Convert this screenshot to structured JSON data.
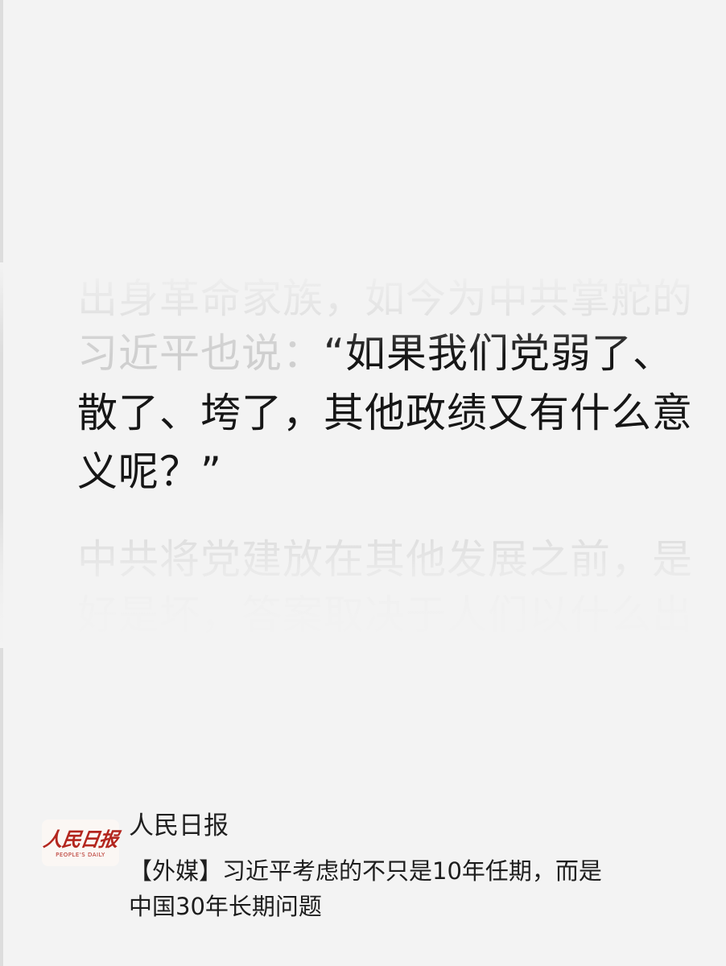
{
  "article_excerpt": {
    "lines": [
      {
        "text": "出身革命家族，如今为中共掌舵的"
      },
      {
        "prefix": "习近平也说：",
        "main": "“如果我们党弱了、"
      },
      {
        "text": "散了、垮了，其他政绩又有什么意"
      },
      {
        "text": "义呢？”"
      },
      {
        "text": "中共将党建放在其他发展之前，是"
      },
      {
        "text": "好是坏，答案取决于人们以什么出"
      }
    ]
  },
  "source": {
    "logo": {
      "chinese": "人民日报",
      "english": "PEOPLE'S DAILY",
      "color": "#b3261e"
    },
    "name": "人民日报",
    "headline": {
      "line1": "【外媒】习近平考虑的不只是10年任期，而是",
      "line2": "中国30年长期问题"
    }
  }
}
